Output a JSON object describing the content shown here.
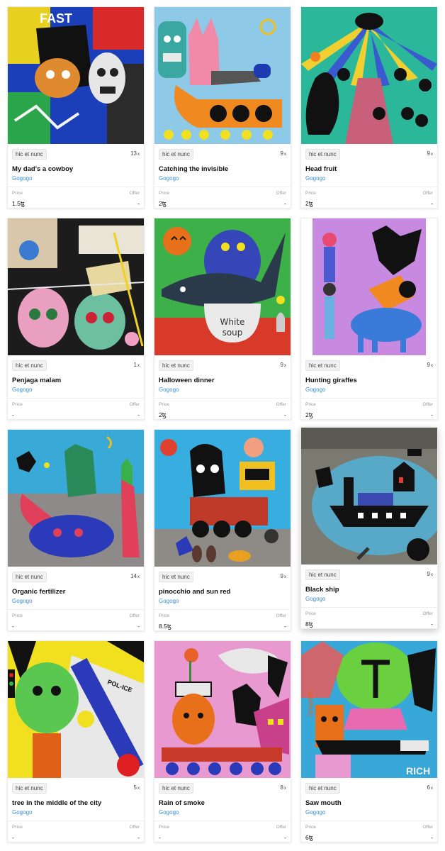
{
  "currency_symbol": "ꜩ",
  "cards": [
    {
      "platform": "hic et nunc",
      "editions": "13",
      "editions_suffix": "x",
      "title": "My dad's a cowboy",
      "artist": "Gogogo",
      "price_label": "Price",
      "price": "1.5ꜩ",
      "offer_label": "Offer",
      "offer": "-"
    },
    {
      "platform": "hic et nunc",
      "editions": "9",
      "editions_suffix": "x",
      "title": "Catching the invisible",
      "artist": "Gogogo",
      "price_label": "Price",
      "price": "2ꜩ",
      "offer_label": "Offer",
      "offer": "-"
    },
    {
      "platform": "hic et nunc",
      "editions": "9",
      "editions_suffix": "x",
      "title": "Head fruit",
      "artist": "Gogogo",
      "price_label": "Price",
      "price": "2ꜩ",
      "offer_label": "Offer",
      "offer": "-"
    },
    {
      "platform": "hic et nunc",
      "editions": "1",
      "editions_suffix": "x",
      "title": "Penjaga malam",
      "artist": "Gogogo",
      "price_label": "Price",
      "price": "-",
      "offer_label": "Offer",
      "offer": "-"
    },
    {
      "platform": "hic et nunc",
      "editions": "9",
      "editions_suffix": "x",
      "title": "Halloween dinner",
      "artist": "Gogogo",
      "price_label": "Price",
      "price": "2ꜩ",
      "offer_label": "Offer",
      "offer": "-"
    },
    {
      "platform": "hic et nunc",
      "editions": "9",
      "editions_suffix": "x",
      "title": "Hunting giraffes",
      "artist": "Gogogo",
      "price_label": "Price",
      "price": "2ꜩ",
      "offer_label": "Offer",
      "offer": "-"
    },
    {
      "platform": "hic et nunc",
      "editions": "14",
      "editions_suffix": "x",
      "title": "Organic fertilizer",
      "artist": "Gogogo",
      "price_label": "Price",
      "price": "-",
      "offer_label": "Offer",
      "offer": "-"
    },
    {
      "platform": "hic et nunc",
      "editions": "9",
      "editions_suffix": "x",
      "title": "pinocchio and sun red",
      "artist": "Gogogo",
      "price_label": "Price",
      "price": "8.5ꜩ",
      "offer_label": "Offer",
      "offer": "-"
    },
    {
      "platform": "hic et nunc",
      "editions": "9",
      "editions_suffix": "x",
      "title": "Black ship",
      "artist": "Gogogo",
      "price_label": "Price",
      "price": "8ꜩ",
      "offer_label": "Offer",
      "offer": "-"
    },
    {
      "platform": "hic et nunc",
      "editions": "5",
      "editions_suffix": "x",
      "title": "tree in the middle of the city",
      "artist": "Gogogo",
      "price_label": "Price",
      "price": "-",
      "offer_label": "Offer",
      "offer": "-"
    },
    {
      "platform": "hic et nunc",
      "editions": "8",
      "editions_suffix": "x",
      "title": "Rain of smoke",
      "artist": "Gogogo",
      "price_label": "Price",
      "price": "-",
      "offer_label": "Offer",
      "offer": "-"
    },
    {
      "platform": "hic et nunc",
      "editions": "6",
      "editions_suffix": "x",
      "title": "Saw mouth",
      "artist": "Gogogo",
      "price_label": "Price",
      "price": "6ꜩ",
      "offer_label": "Offer",
      "offer": "-"
    }
  ],
  "artwork_text": {
    "cowboy_scrawl": "FAST",
    "soup_line1": "White",
    "soup_line2": "soup",
    "city_sign": "POL-ICE",
    "warning_word": "WARNIG",
    "rich_word": "RICH"
  },
  "colors": {
    "artist_link": "#3b8fd0",
    "card_border": "#ececec",
    "label_gray": "#9a9a9a"
  }
}
